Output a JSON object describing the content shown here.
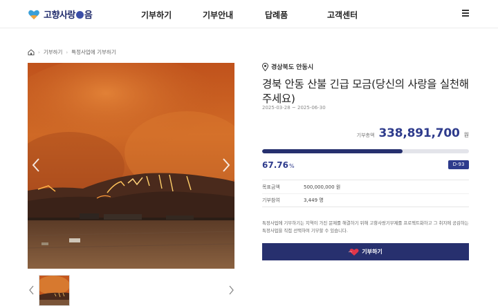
{
  "header": {
    "logo_text_1": "고향사랑",
    "logo_text_2": "음",
    "nav": [
      "기부하기",
      "기부안내",
      "답례품",
      "고객센터"
    ]
  },
  "breadcrumb": {
    "items": [
      "기부하기",
      "특정사업에 기부하기"
    ]
  },
  "campaign": {
    "location": "경상북도 안동시",
    "title": "경북 안동 산불 긴급 모금(당신의 사랑을 실천해주세요)",
    "period": "2025-03-28 ~ 2025-06-30",
    "amount_label": "기부총액",
    "amount_value": "338,891,700",
    "amount_unit": "원",
    "progress_fraction": 0.6776,
    "percent_value": "67.76",
    "percent_unit": "%",
    "dday": "D-93",
    "info": [
      {
        "label": "목표금액",
        "value": "500,000,000 원"
      },
      {
        "label": "기부참여",
        "value": "3,449 명"
      }
    ],
    "description": "특정사업에 기부하기는 지역이 가진 문제를 해결하기 위해 고향사랑기부제를 프로젝트화하고 그 취지에 공감하는 특정사업을 직접 선택하여 기부할 수 있습니다.",
    "donate_label": "기부하기"
  },
  "colors": {
    "brand": "#2e3b8c",
    "button": "#27306e",
    "fire": "#e06a1f"
  },
  "icons": [
    "home-icon",
    "location-pin-icon",
    "menu-icon",
    "heart-icon",
    "chevron-left-icon",
    "chevron-right-icon"
  ]
}
